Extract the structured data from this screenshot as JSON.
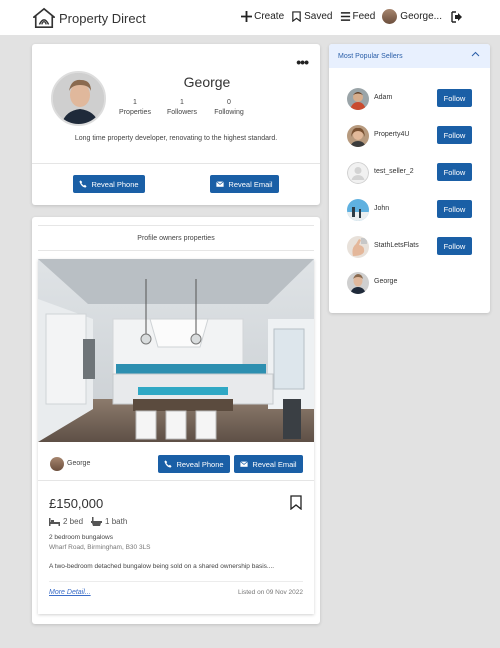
{
  "navbar": {
    "brand": "Property Direct",
    "create": "Create",
    "saved": "Saved",
    "feed": "Feed",
    "user": "George..."
  },
  "profile": {
    "name": "George",
    "stats": [
      {
        "value": "1",
        "label": "Properties"
      },
      {
        "value": "1",
        "label": "Followers"
      },
      {
        "value": "0",
        "label": "Following"
      }
    ],
    "bio": "Long time property developer, renovating to the highest standard.",
    "reveal_phone": "Reveal Phone",
    "reveal_email": "Reveal Email"
  },
  "properties": {
    "section_title": "Profile owners properties",
    "owner": "George",
    "reveal_phone": "Reveal Phone",
    "reveal_email": "Reveal Email",
    "price": "£150,000",
    "beds": "2 bed",
    "baths": "1 bath",
    "type": "2 bedroom bungalows",
    "address": "Wharf Road, Birmingham, B30 3LS",
    "description": "A two-bedroom detached bungalow being sold on a shared ownership basis....",
    "more": "More Detail...",
    "listed": "Listed on 09 Nov 2022"
  },
  "sellers": {
    "title": "Most Popular Sellers",
    "follow_label": "Follow",
    "items": [
      {
        "name": "Adam",
        "avatar": "man-face",
        "follow": true
      },
      {
        "name": "Property4U",
        "avatar": "woman-face",
        "follow": true
      },
      {
        "name": "test_seller_2",
        "avatar": "default-user",
        "follow": true
      },
      {
        "name": "John",
        "avatar": "sky-photo",
        "follow": true
      },
      {
        "name": "StathLetsFlats",
        "avatar": "hand-photo",
        "follow": true
      },
      {
        "name": "George",
        "avatar": "man-face",
        "follow": false
      }
    ]
  },
  "colors": {
    "primary": "#1a5fa6",
    "background": "#e2e2e2",
    "sellers_header": "#e8f0fe"
  }
}
